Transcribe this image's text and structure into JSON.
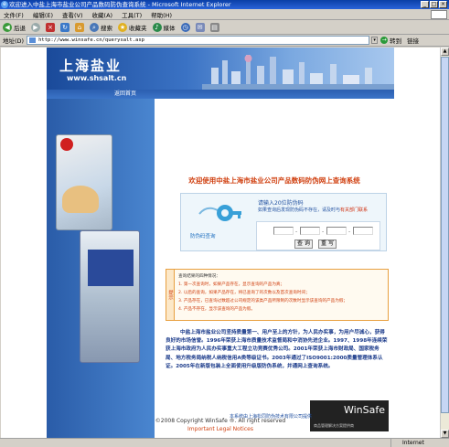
{
  "window": {
    "title": "欢迎进入中盐上海市盐业公司产品数码防伪查询系统 - Microsoft Internet Explorer",
    "menu": [
      "文件(F)",
      "编辑(E)",
      "查看(V)",
      "收藏(A)",
      "工具(T)",
      "帮助(H)"
    ],
    "toolbar": {
      "back": "后退",
      "search": "搜索",
      "favorites": "收藏夹",
      "media": "媒体"
    },
    "address_label": "地址(D)",
    "address_value": "http://www.winsafe.cn/querysalt.asp",
    "go": "转到",
    "links": "链接",
    "status_zone": "Internet"
  },
  "page": {
    "logo": "上海盐业",
    "logo_url": "www.shsalt.cn",
    "nav_home": "返回首页",
    "headline": "欢迎使用中盐上海市盐业公司产品数码防伪网上查询系统",
    "query": {
      "hint1": "请输入20位防伪码",
      "hint2_prefix": "如果查询后发现防伪码不存在，请及时与",
      "hint2_highlight": "有关部门联系",
      "code_label": "防伪码查询",
      "submit": "查 询",
      "reset": "重 写"
    },
    "notice": {
      "tag": "提示",
      "title": "查询结果的四种情况：",
      "lines": [
        "1. 第一次查询时，如果产品存在，显示查询的产品为真；",
        "2. 以后的查询，如果产品存在，将已查询了的次数以及首次查询时间；",
        "3. 产品存在，已查询过数超过公司规定的该类产品所限制的次数时显示该查询的产品为假；",
        "4. 产品不存在，显示该查询的产品为假。"
      ]
    },
    "paragraph": "中盐上海市盐业公司坚持质量第一、用户至上的方针，为人民办实事，为用户尽诚心，获得良好的市场信誉。1996年荣获上海市质量技术监督局和中消协先进企业。1997、1998年连续荣获上海市政府为人民办实事重大工程立功竞赛优秀公司。2001年荣获上海市财政局、国家税务局、地方税务局纳税人纳税信用A类等级证书。2003年通过了ISO9001:2000质量管理体系认证。2005年在新版包装上全面使用升级版防伪系统，并通网上查询系统。",
    "tech_credit": "本系统由上海松同防伪技术有限公司提供",
    "winsafe_brand": "WinSafe",
    "winsafe_sub": "商品管理解决方案提供商",
    "copyright": "©2008 Copyright WinSafe ®. All right reserved",
    "legal": "Important Legal Notices"
  }
}
